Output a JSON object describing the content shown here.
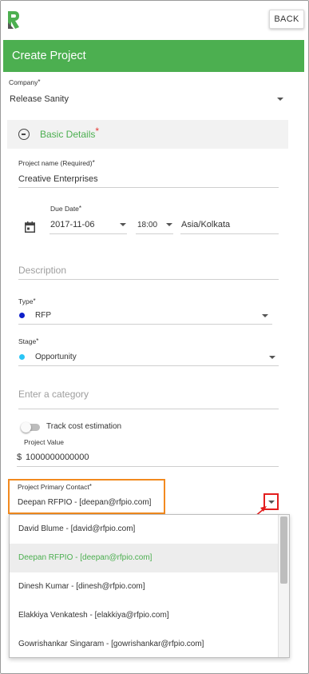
{
  "app": {
    "back_label": "BACK",
    "title": "Create Project",
    "brand_color": "#4caf50"
  },
  "company": {
    "label": "Company",
    "required_mark": "*",
    "value": "Release Sanity"
  },
  "basic_details": {
    "title": "Basic Details",
    "required_mark": "*",
    "icon": "minus-circle-icon"
  },
  "project_name": {
    "label": "Project name (Required)",
    "required_mark": "*",
    "value": "Creative Enterprises"
  },
  "due_date": {
    "label": "Due Date",
    "required_mark": "*",
    "date": "2017-11-06",
    "time": "18:00",
    "timezone": "Asia/Kolkata",
    "icon": "calendar-icon"
  },
  "description": {
    "placeholder": "Description"
  },
  "type": {
    "label": "Type",
    "required_mark": "*",
    "value": "RFP",
    "dot_color": "#0d1fc9"
  },
  "stage": {
    "label": "Stage",
    "required_mark": "*",
    "value": "Opportunity",
    "dot_color": "#29c5f6"
  },
  "category": {
    "placeholder": "Enter a category"
  },
  "cost_estimation": {
    "label": "Track cost estimation",
    "enabled": false
  },
  "project_value": {
    "label": "Project Value",
    "currency": "$",
    "value": "1000000000000"
  },
  "primary_contact": {
    "label": "Project Primary Contact",
    "required_mark": "*",
    "value": "Deepan RFPIO - [deepan@rfpio.com]",
    "highlight_color": "#f28a1f",
    "caret_highlight_color": "#e31e1e",
    "options": [
      {
        "label": "David Blume - [david@rfpio.com]",
        "selected": false
      },
      {
        "label": "Deepan RFPIO - [deepan@rfpio.com]",
        "selected": true
      },
      {
        "label": "Dinesh Kumar - [dinesh@rfpio.com]",
        "selected": false
      },
      {
        "label": "Elakkiya Venkatesh - [elakkiya@rfpio.com]",
        "selected": false
      },
      {
        "label": "Gowrishankar Singaram - [gowrishankar@rfpio.com]",
        "selected": false
      }
    ]
  }
}
